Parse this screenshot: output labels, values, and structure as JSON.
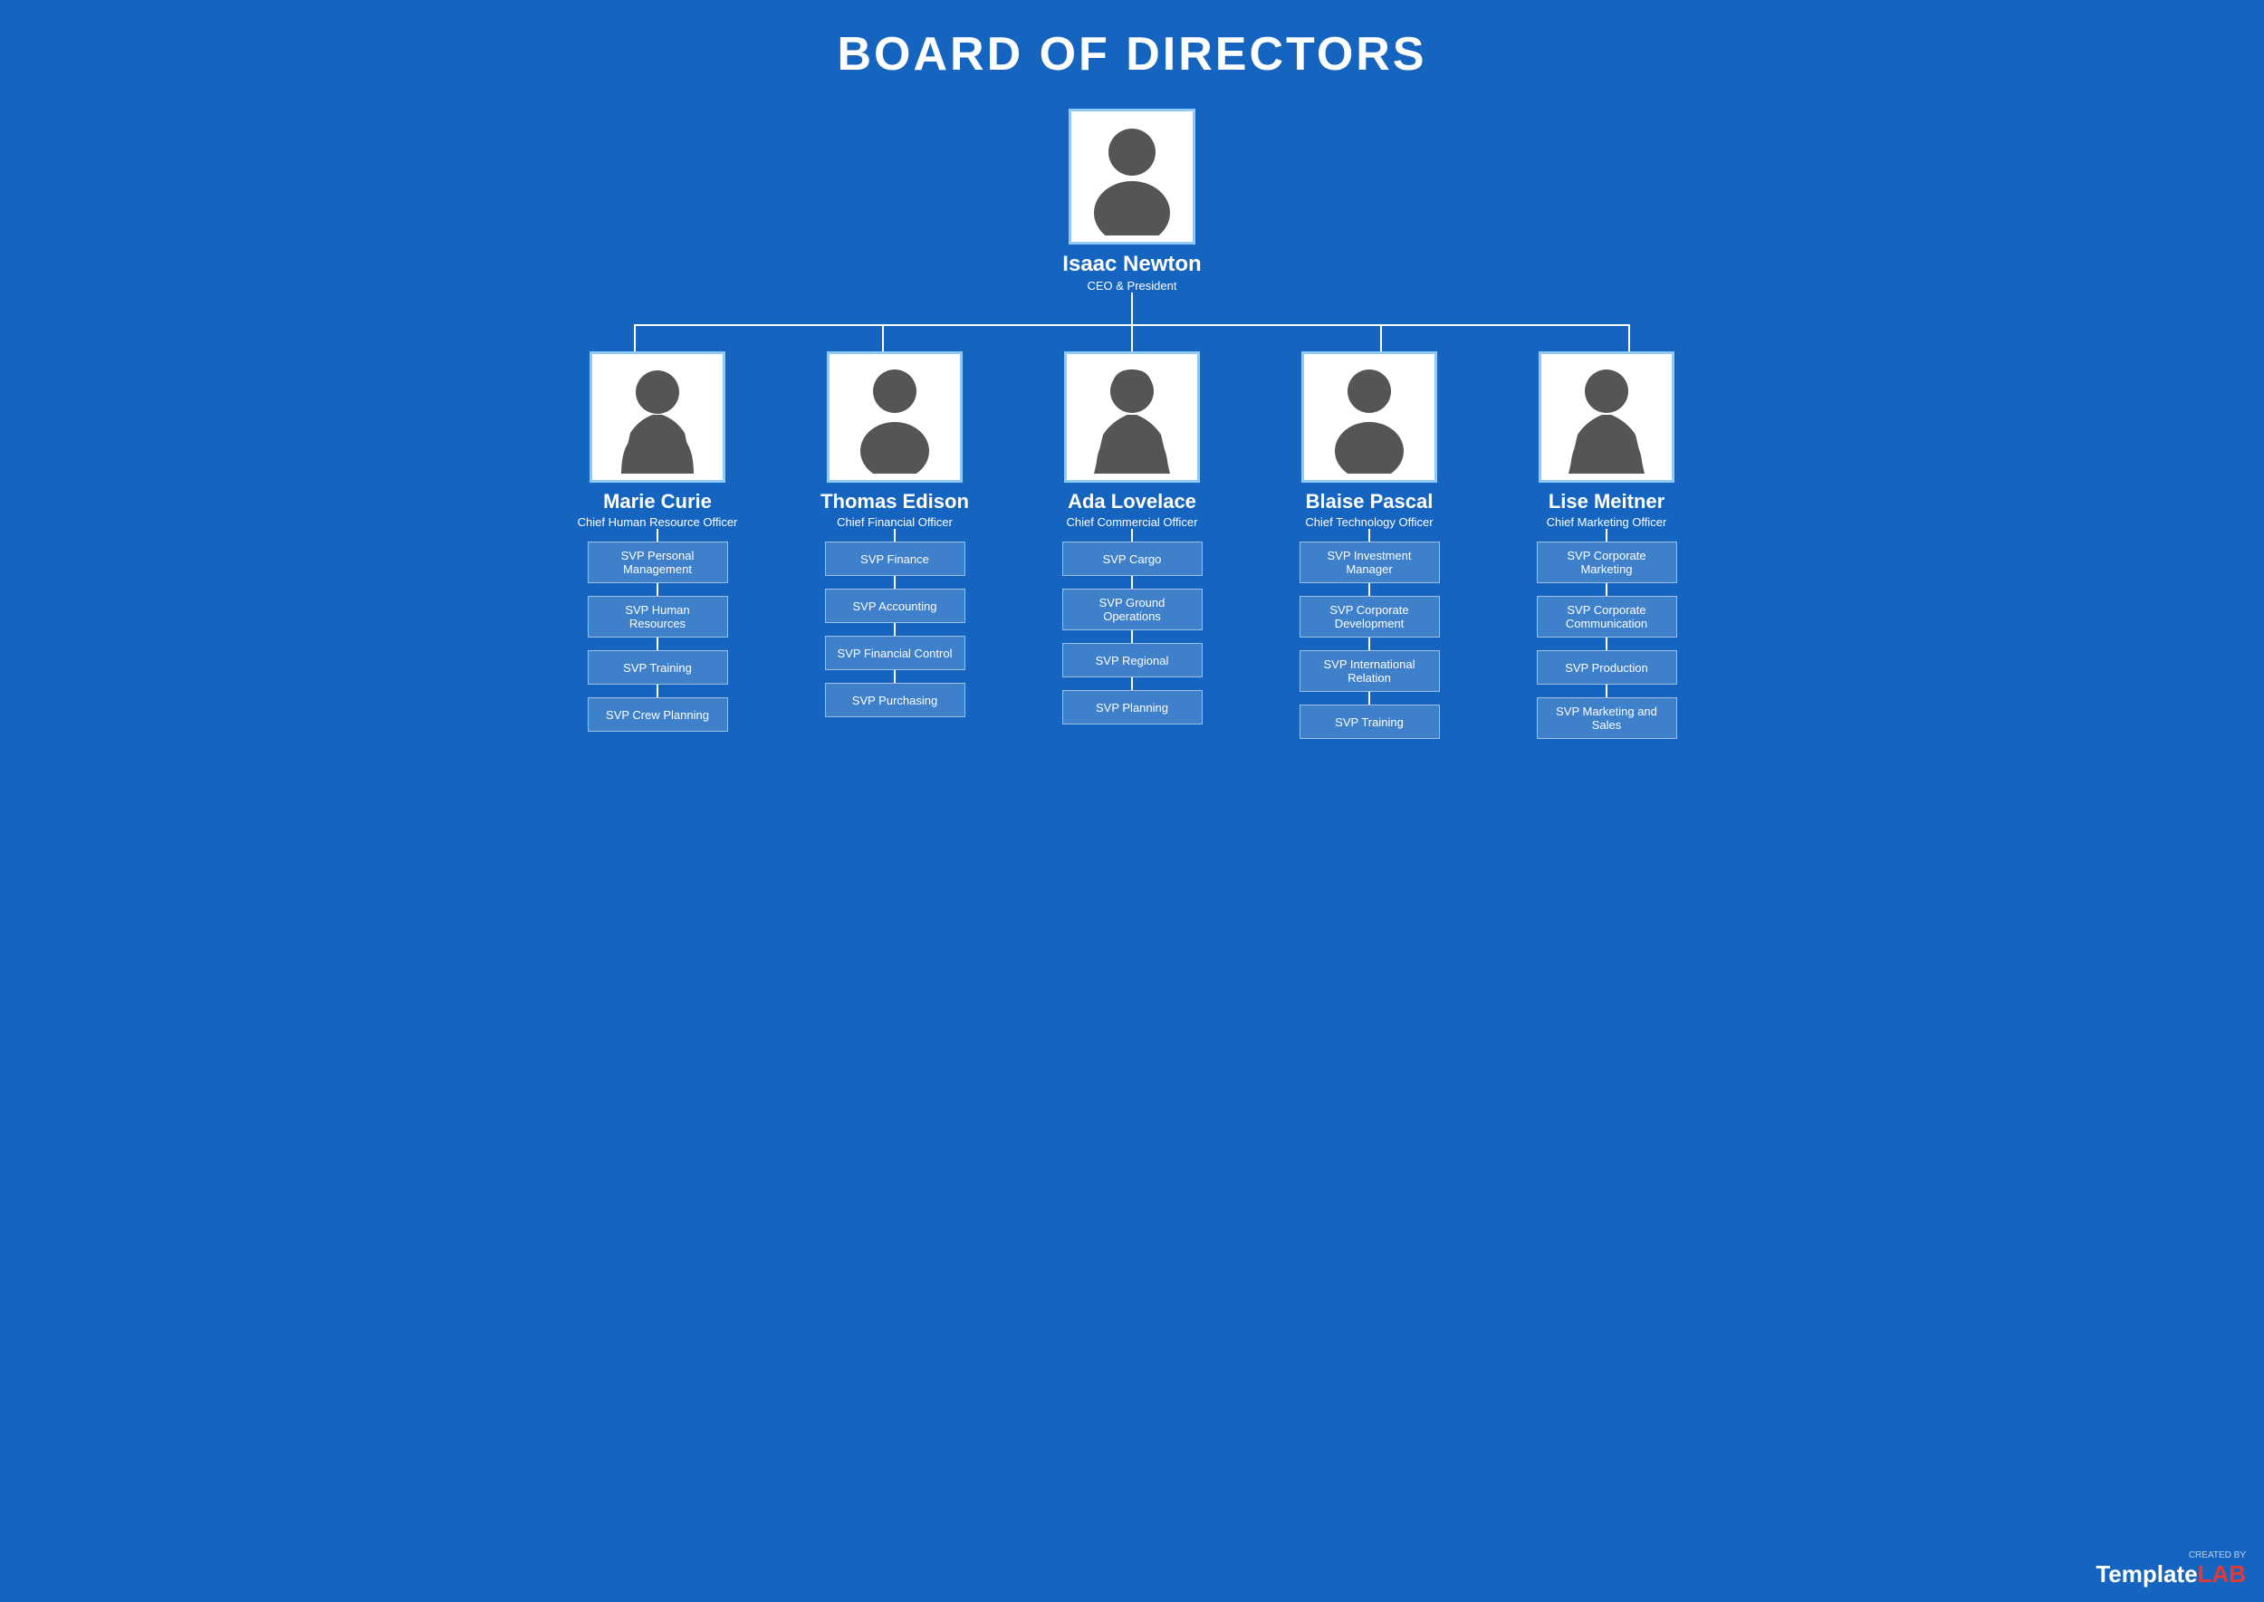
{
  "title": "BOARD OF DIRECTORS",
  "ceo": {
    "name": "Isaac Newton",
    "title": "CEO & President"
  },
  "directors": [
    {
      "name": "Marie Curie",
      "title": "Chief Human Resource Officer",
      "svps": [
        "SVP Personal Management",
        "SVP Human Resources",
        "SVP Training",
        "SVP Crew Planning"
      ]
    },
    {
      "name": "Thomas Edison",
      "title": "Chief Financial Officer",
      "svps": [
        "SVP Finance",
        "SVP Accounting",
        "SVP Financial Control",
        "SVP Purchasing"
      ]
    },
    {
      "name": "Ada Lovelace",
      "title": "Chief Commercial Officer",
      "svps": [
        "SVP Cargo",
        "SVP Ground Operations",
        "SVP Regional",
        "SVP Planning"
      ]
    },
    {
      "name": "Blaise Pascal",
      "title": "Chief Technology Officer",
      "svps": [
        "SVP Investment Manager",
        "SVP Corporate Development",
        "SVP International Relation",
        "SVP Training"
      ]
    },
    {
      "name": "Lise Meitner",
      "title": "Chief Marketing Officer",
      "svps": [
        "SVP Corporate Marketing",
        "SVP Corporate Communication",
        "SVP Production",
        "SVP Marketing and Sales"
      ]
    }
  ],
  "logo": {
    "created_by": "CREATED BY",
    "template": "Template",
    "lab": "LAB"
  },
  "silhouette_colors": {
    "body": "#555555",
    "frame_bg": "#ffffff",
    "frame_border": "#90CAF9"
  }
}
